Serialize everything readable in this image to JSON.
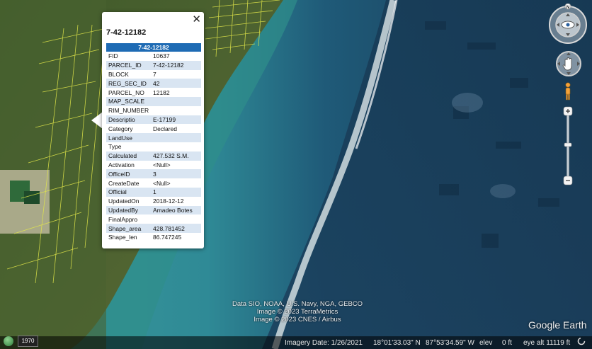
{
  "popup": {
    "title": "7-42-12182",
    "header": "7-42-12182",
    "close_label": "✕",
    "rows": [
      {
        "key": "FID",
        "value": "10637"
      },
      {
        "key": "PARCEL_ID",
        "value": "7-42-12182"
      },
      {
        "key": "BLOCK",
        "value": "7"
      },
      {
        "key": "REG_SEC_ID",
        "value": "42"
      },
      {
        "key": "PARCEL_NO",
        "value": "12182"
      },
      {
        "key": "MAP_SCALE",
        "value": ""
      },
      {
        "key": "RIM_NUMBER",
        "value": ""
      },
      {
        "key": "Descriptio",
        "value": "E-17199"
      },
      {
        "key": "Category",
        "value": "Declared"
      },
      {
        "key": "LandUse",
        "value": ""
      },
      {
        "key": "Type",
        "value": ""
      },
      {
        "key": "Calculated",
        "value": "427.532 S.M."
      },
      {
        "key": "Activation",
        "value": "<Null>"
      },
      {
        "key": "OfficeID",
        "value": "3"
      },
      {
        "key": "CreateDate",
        "value": "<Null>"
      },
      {
        "key": "Official",
        "value": "1"
      },
      {
        "key": "UpdatedOn",
        "value": "2018-12-12"
      },
      {
        "key": "UpdatedBy",
        "value": "Amadeo Botes"
      },
      {
        "key": "FinalAppro",
        "value": ""
      },
      {
        "key": "Shape_area",
        "value": "428.781452"
      },
      {
        "key": "Shape_len",
        "value": "86.747245"
      }
    ]
  },
  "credits": [
    "Data SIO, NOAA, U.S. Navy, NGA, GEBCO",
    "Image © 2023 TerraMetrics",
    "Image © 2023 CNES / Airbus"
  ],
  "brand": "Google Earth",
  "navigation": {
    "north_label": "N"
  },
  "status": {
    "year": "1970",
    "imagery_date": "Imagery Date: 1/26/2021",
    "latitude": "18°01'33.03\" N",
    "longitude": "87°53'34.59\" W",
    "elev_label": "elev",
    "elev_value": "0 ft",
    "eye_alt": "eye alt  11119 ft"
  },
  "colors": {
    "header_blue": "#1e6bb4",
    "row_stripe": "#d9e5f2",
    "parcel_lines": "#e3e84a"
  }
}
